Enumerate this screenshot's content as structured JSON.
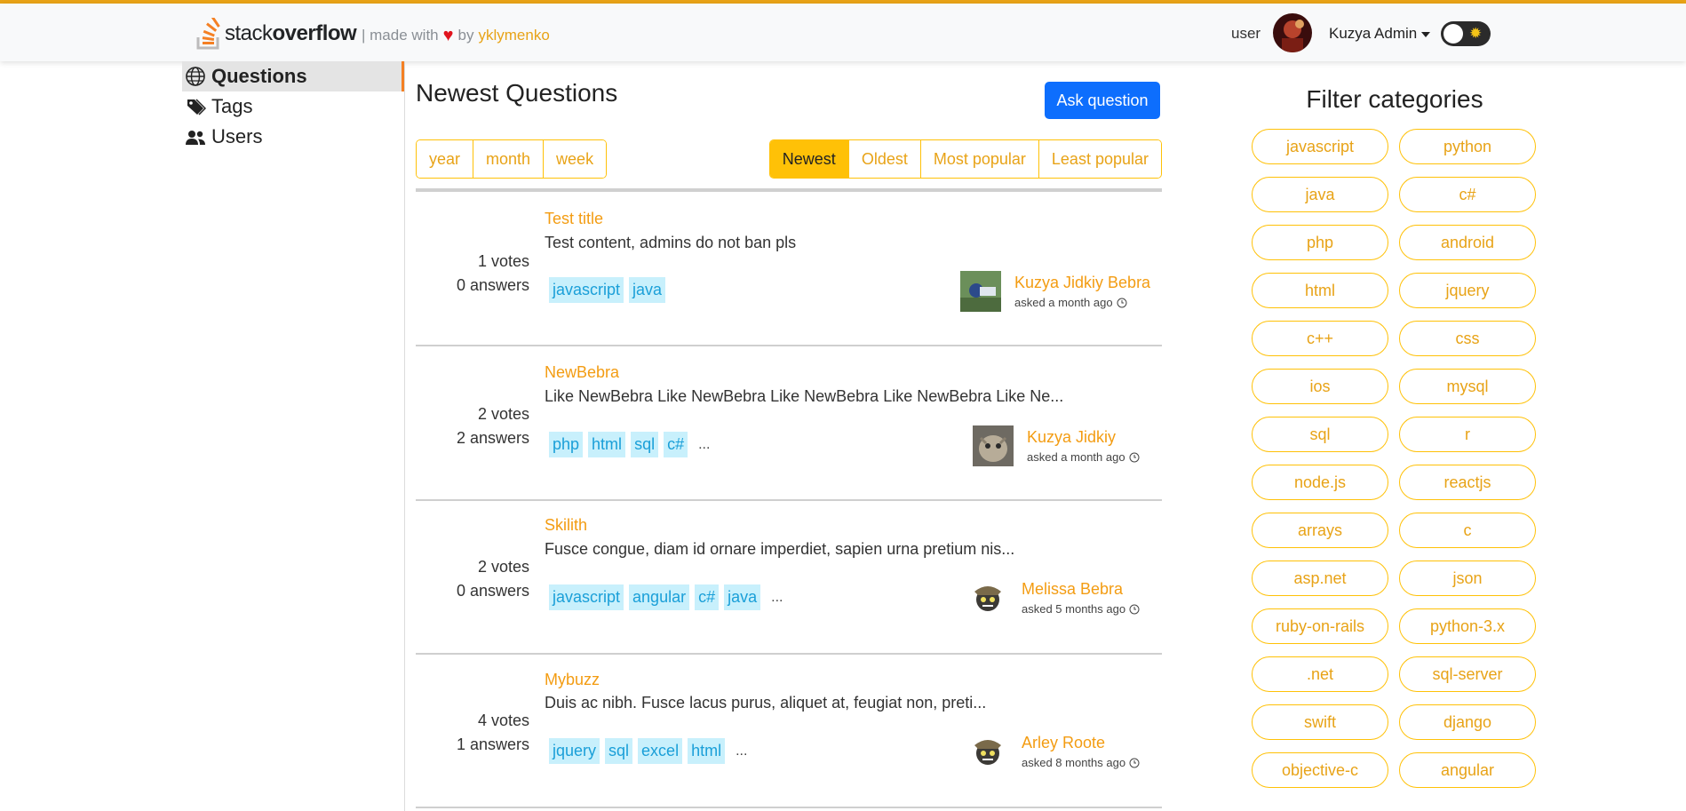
{
  "brand": {
    "logo_light": "stack",
    "logo_bold": "overflow",
    "made_with": "| made with",
    "by": "by",
    "author": "yklymenko"
  },
  "header": {
    "role": "user",
    "username": "Kuzya Admin"
  },
  "sidebar": {
    "items": [
      {
        "label": "Questions",
        "icon": "globe-icon",
        "active": true
      },
      {
        "label": "Tags",
        "icon": "tags-icon",
        "active": false
      },
      {
        "label": "Users",
        "icon": "users-icon",
        "active": false
      }
    ]
  },
  "main": {
    "title": "Newest Questions",
    "ask_label": "Ask question",
    "period_filters": [
      "year",
      "month",
      "week"
    ],
    "sort_filters": [
      "Newest",
      "Oldest",
      "Most popular",
      "Least popular"
    ],
    "active_sort": "Newest",
    "questions": [
      {
        "votes": "1 votes",
        "answers": "0 answers",
        "title": "Test title",
        "excerpt": "Test content, admins do not ban pls",
        "tags": [
          "javascript",
          "java"
        ],
        "more": "",
        "author": "Kuzya Jidkiy Bebra",
        "asked": "asked a month ago"
      },
      {
        "votes": "2 votes",
        "answers": "2 answers",
        "title": "NewBebra",
        "excerpt": "Like NewBebra Like NewBebra Like NewBebra Like NewBebra Like Ne...",
        "tags": [
          "php",
          "html",
          "sql",
          "c#"
        ],
        "more": "...",
        "author": "Kuzya Jidkiy",
        "asked": "asked a month ago"
      },
      {
        "votes": "2 votes",
        "answers": "0 answers",
        "title": "Skilith",
        "excerpt": "Fusce congue, diam id ornare imperdiet, sapien urna pretium nis...",
        "tags": [
          "javascript",
          "angular",
          "c#",
          "java"
        ],
        "more": "...",
        "author": "Melissa Bebra",
        "asked": "asked 5 months ago"
      },
      {
        "votes": "4 votes",
        "answers": "1 answers",
        "title": "Mybuzz",
        "excerpt": "Duis ac nibh. Fusce lacus purus, aliquet at, feugiat non, preti...",
        "tags": [
          "jquery",
          "sql",
          "excel",
          "html"
        ],
        "more": "...",
        "author": "Arley Roote",
        "asked": "asked 8 months ago"
      }
    ]
  },
  "filter": {
    "title": "Filter categories",
    "categories": [
      "javascript",
      "python",
      "java",
      "c#",
      "php",
      "android",
      "html",
      "jquery",
      "c++",
      "css",
      "ios",
      "mysql",
      "sql",
      "r",
      "node.js",
      "reactjs",
      "arrays",
      "c",
      "asp.net",
      "json",
      "ruby-on-rails",
      "python-3.x",
      ".net",
      "sql-server",
      "swift",
      "django",
      "objective-c",
      "angular"
    ]
  },
  "colors": {
    "accent": "#ffc107",
    "link": "#f39c12",
    "primary": "#0d6efd",
    "tag_bg": "#c8f0fc",
    "tag_text": "#1a9fd8"
  }
}
